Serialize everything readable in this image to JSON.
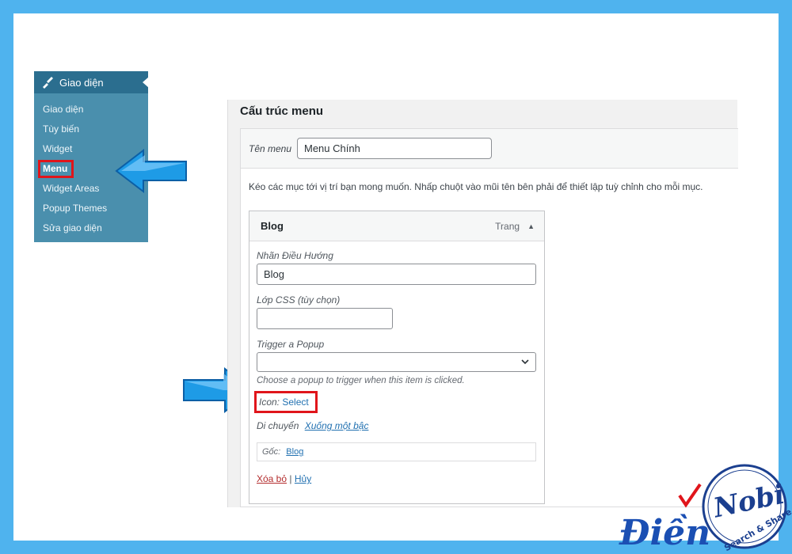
{
  "sidebar": {
    "header": "Giao diện",
    "items": [
      {
        "label": "Giao diện"
      },
      {
        "label": "Tùy biến"
      },
      {
        "label": "Widget"
      },
      {
        "label": "Menu"
      },
      {
        "label": "Widget Areas"
      },
      {
        "label": "Popup Themes"
      },
      {
        "label": "Sửa giao diện"
      }
    ],
    "colors": {
      "background": "#4a8fad",
      "header": "#2b6e8f",
      "highlight": "#e0151b"
    }
  },
  "panel": {
    "title": "Cấu trúc menu",
    "menu_name_label": "Tên menu",
    "menu_name_value": "Menu Chính",
    "instructions": "Kéo các mục tới vị trí bạn mong muốn. Nhấp chuột vào mũi tên bên phải để thiết lập tuỳ chỉnh cho mỗi mục."
  },
  "menu_item": {
    "title": "Blog",
    "type": "Trang",
    "nav_label": "Nhãn Điều Hướng",
    "nav_value": "Blog",
    "css_label": "Lớp CSS (tùy chọn)",
    "css_value": "",
    "popup_label": "Trigger a Popup",
    "popup_value": "",
    "popup_help": "Choose a popup to trigger when this item is clicked.",
    "icon_label": "Icon:",
    "icon_link": "Select",
    "move_label": "Di chuyển",
    "move_link": "Xuống một bậc",
    "original_label": "Gốc:",
    "original_link": "Blog",
    "remove_link": "Xóa bỏ",
    "separator": "|",
    "cancel_link": "Hủy"
  },
  "logo": {
    "text_main": "Điền",
    "text_nobi": "Nobi",
    "tagline": "Search & Share"
  },
  "colors": {
    "frame": "#4fb3ee",
    "arrow": "#1e9be6",
    "link": "#2271b1"
  }
}
